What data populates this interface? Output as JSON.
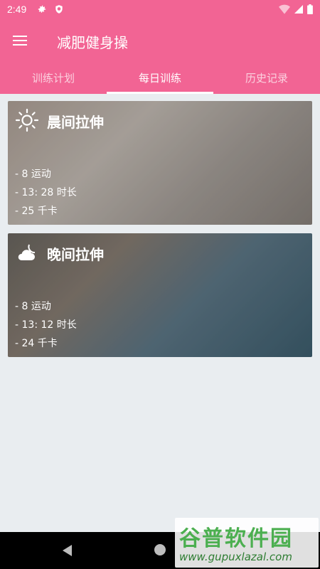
{
  "status_bar": {
    "time": "2:49",
    "left_icons": [
      "gear-icon",
      "shield-icon"
    ],
    "right_icons": [
      "wifi-icon",
      "cellular-signal-icon",
      "battery-icon"
    ]
  },
  "app_bar": {
    "title": "减肥健身操",
    "menu_icon": "hamburger-menu-icon"
  },
  "tabs": [
    {
      "label": "训练计划",
      "active": false
    },
    {
      "label": "每日训练",
      "active": true
    },
    {
      "label": "历史记录",
      "active": false
    }
  ],
  "cards": [
    {
      "title": "晨间拉伸",
      "icon": "sun-icon",
      "exercises": "- 8 运动",
      "duration": "- 13: 28 时长",
      "calories": "- 25 千卡"
    },
    {
      "title": "晚间拉伸",
      "icon": "moon-cloud-icon",
      "exercises": "- 8 运动",
      "duration": "- 13: 12 时长",
      "calories": "- 24 千卡"
    }
  ],
  "watermark": {
    "text_large": "谷普软件园",
    "text_small": "www.gupuxlazal.com"
  },
  "colors": {
    "primary": "#f26494",
    "background": "#e9edf0"
  }
}
